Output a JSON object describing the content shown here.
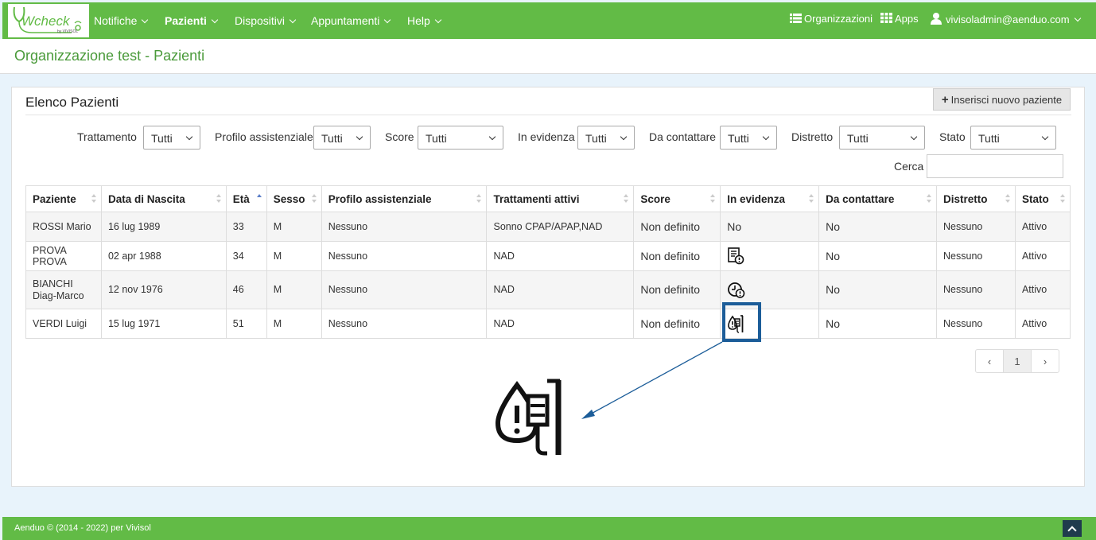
{
  "header": {
    "logo": "Wcheck",
    "logo_sub": "by VIVISOL",
    "nav": [
      {
        "label": "Notifiche"
      },
      {
        "label": "Pazienti"
      },
      {
        "label": "Dispositivi"
      },
      {
        "label": "Appuntamenti"
      },
      {
        "label": "Help"
      }
    ],
    "organizations": "Organizzazioni",
    "apps": "Apps",
    "user": "vivisoladmin@aenduo.com",
    "accent_color": "#62bb46"
  },
  "page_title": "Organizzazione test - Pazienti",
  "panel": {
    "title": "Elenco Pazienti",
    "add_button": "Inserisci nuovo paziente"
  },
  "filters": [
    {
      "label": "Trattamento",
      "value": "Tutti"
    },
    {
      "label": "Profilo assistenziale",
      "value": "Tutti"
    },
    {
      "label": "Score",
      "value": "Tutti"
    },
    {
      "label": "In evidenza",
      "value": "Tutti"
    },
    {
      "label": "Da contattare",
      "value": "Tutti"
    },
    {
      "label": "Distretto",
      "value": "Tutti"
    },
    {
      "label": "Stato",
      "value": "Tutti"
    }
  ],
  "search": {
    "label": "Cerca",
    "value": ""
  },
  "table": {
    "columns": [
      "Paziente",
      "Data di Nascita",
      "Età",
      "Sesso",
      "Profilo assistenziale",
      "Trattamenti attivi",
      "Score",
      "In evidenza",
      "Da contattare",
      "Distretto",
      "Stato"
    ],
    "rows": [
      {
        "paziente": "ROSSI Mario",
        "nascita": "16 lug 1989",
        "eta": "33",
        "sesso": "M",
        "profilo": "Nessuno",
        "trattamenti": "Sonno CPAP/APAP,NAD",
        "score": "Non definito",
        "evidenza": "No",
        "evidenza_icon": "",
        "contattare": "No",
        "distretto": "Nessuno",
        "stato": "Attivo"
      },
      {
        "paziente": "PROVA PROVA",
        "nascita": "02 apr 1988",
        "eta": "34",
        "sesso": "M",
        "profilo": "Nessuno",
        "trattamenti": "NAD",
        "score": "Non definito",
        "evidenza": "",
        "evidenza_icon": "document-alert-icon",
        "contattare": "No",
        "distretto": "Nessuno",
        "stato": "Attivo"
      },
      {
        "paziente": "BIANCHI Diag-Marco",
        "nascita": "12 nov 1976",
        "eta": "46",
        "sesso": "M",
        "profilo": "Nessuno",
        "trattamenti": "NAD",
        "score": "Non definito",
        "evidenza": "",
        "evidenza_icon": "clock-alert-icon",
        "contattare": "No",
        "distretto": "Nessuno",
        "stato": "Attivo"
      },
      {
        "paziente": "VERDI Luigi",
        "nascita": "15 lug 1971",
        "eta": "51",
        "sesso": "M",
        "profilo": "Nessuno",
        "trattamenti": "NAD",
        "score": "Non definito",
        "evidenza": "",
        "evidenza_icon": "drop-alert-icon",
        "contattare": "No",
        "distretto": "Nessuno",
        "stato": "Attivo"
      }
    ]
  },
  "pagination": {
    "prev": "‹",
    "current": "1",
    "next": "›"
  },
  "footer": {
    "text": "Aenduo © (2014 - 2022) per Vivisol"
  }
}
